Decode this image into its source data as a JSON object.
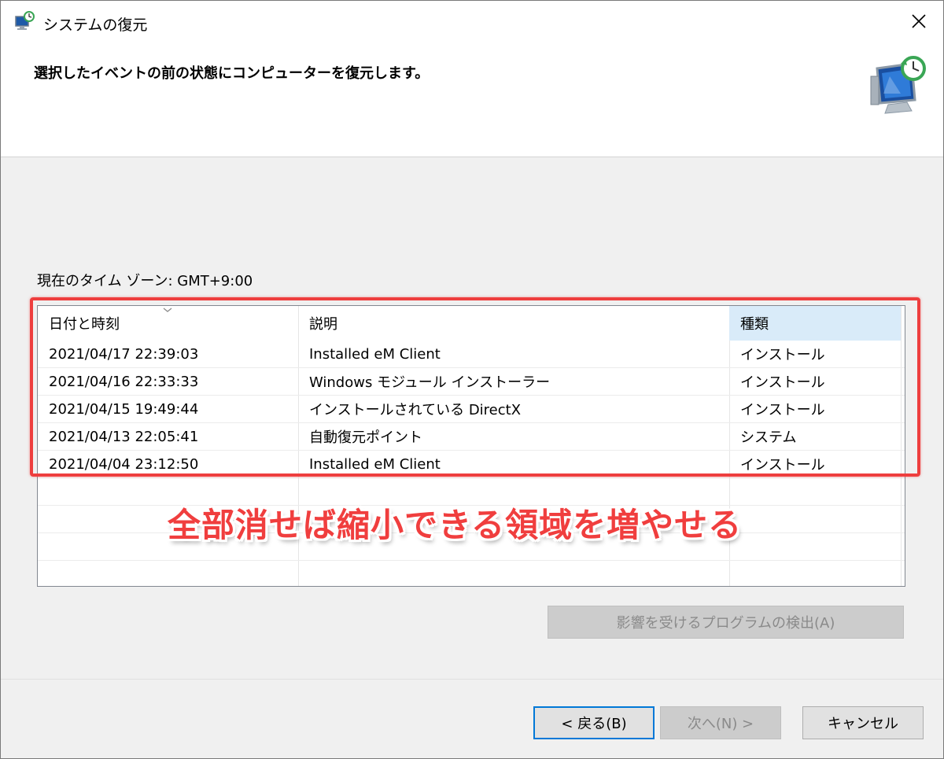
{
  "window": {
    "title": "システムの復元",
    "close_label": "✕"
  },
  "header": {
    "instruction": "選択したイベントの前の状態にコンピューターを復元します。"
  },
  "timezone_label": "現在のタイム ゾーン: GMT+9:00",
  "table": {
    "columns": [
      "日付と時刻",
      "説明",
      "種類"
    ],
    "rows": [
      {
        "datetime": "2021/04/17 22:39:03",
        "description": "Installed eM Client",
        "type": "インストール"
      },
      {
        "datetime": "2021/04/16 22:33:33",
        "description": "Windows モジュール インストーラー",
        "type": "インストール"
      },
      {
        "datetime": "2021/04/15 19:49:44",
        "description": "インストールされている DirectX",
        "type": "インストール"
      },
      {
        "datetime": "2021/04/13 22:05:41",
        "description": "自動復元ポイント",
        "type": "システム"
      },
      {
        "datetime": "2021/04/04 23:12:50",
        "description": "Installed eM Client",
        "type": "インストール"
      }
    ]
  },
  "annotation": {
    "text": "全部消せば縮小できる領域を増やせる",
    "color": "#f03e3e"
  },
  "buttons": {
    "affected": "影響を受けるプログラムの検出(A)",
    "back": "< 戻る(B)",
    "next": "次へ(N) >",
    "cancel": "キャンセル"
  },
  "icons": {
    "title": "system-restore-icon",
    "header": "monitor-restore-icon",
    "sort": "chevron-down-icon",
    "close": "close-icon"
  },
  "colors": {
    "accent": "#0078d7",
    "highlight_border": "#ee3e3e",
    "sorted_header": "#d9ebf9"
  }
}
